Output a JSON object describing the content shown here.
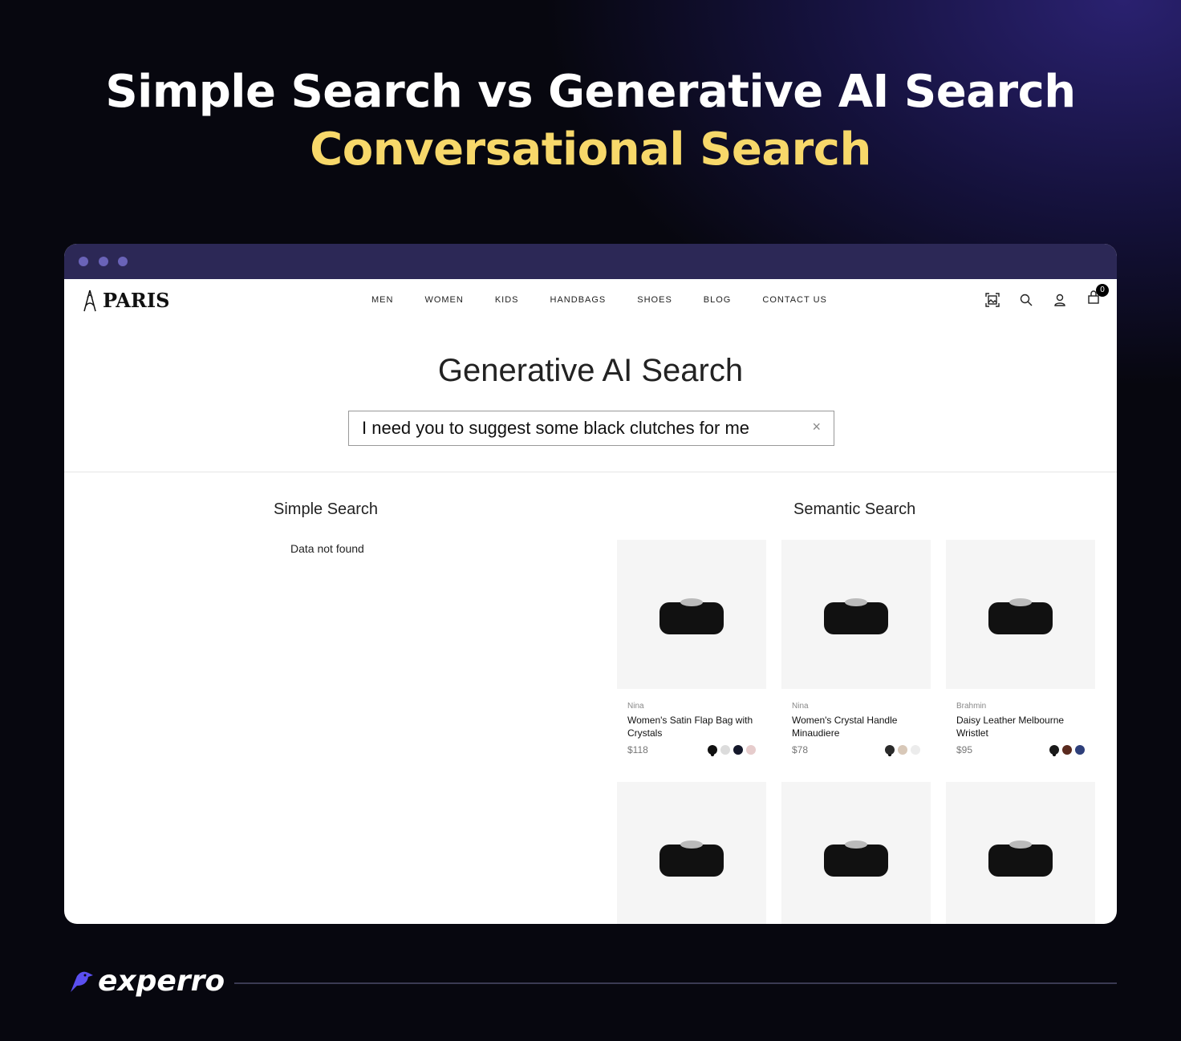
{
  "headline": {
    "line1": "Simple Search vs Generative AI Search",
    "line2": "Conversational Search"
  },
  "site": {
    "logo": "PARIS",
    "nav": [
      "MEN",
      "WOMEN",
      "KIDS",
      "HANDBAGS",
      "SHOES",
      "BLOG",
      "CONTACT US"
    ],
    "cart_count": "0",
    "icons": [
      "image-search-icon",
      "search-icon",
      "user-icon",
      "cart-icon"
    ]
  },
  "page": {
    "title": "Generative AI Search",
    "search_value": "I need you to suggest some black clutches for me",
    "clear": "×"
  },
  "simple": {
    "heading": "Simple Search",
    "empty": "Data not found"
  },
  "semantic": {
    "heading": "Semantic Search",
    "products": [
      {
        "brand": "Nina",
        "name": "Women's Satin Flap Bag with Crystals",
        "price": "$118",
        "swatches": [
          "#111111",
          "#dcdcdc",
          "#14182a",
          "#e6cccc"
        ]
      },
      {
        "brand": "Nina",
        "name": "Women's Crystal Handle Minaudiere",
        "price": "$78",
        "swatches": [
          "#2a2a2a",
          "#d8c8b8",
          "#ececec"
        ]
      },
      {
        "brand": "Brahmin",
        "name": "Daisy Leather Melbourne Wristlet",
        "price": "$95",
        "swatches": [
          "#1a1a1a",
          "#5a2a1e",
          "#2e3f7a"
        ]
      },
      {},
      {},
      {}
    ]
  },
  "footer": {
    "brand": "experro"
  },
  "colors": {
    "accent": "#f7d86a",
    "window_bar": "#2c2856",
    "brand_blue": "#5a4ff0"
  }
}
